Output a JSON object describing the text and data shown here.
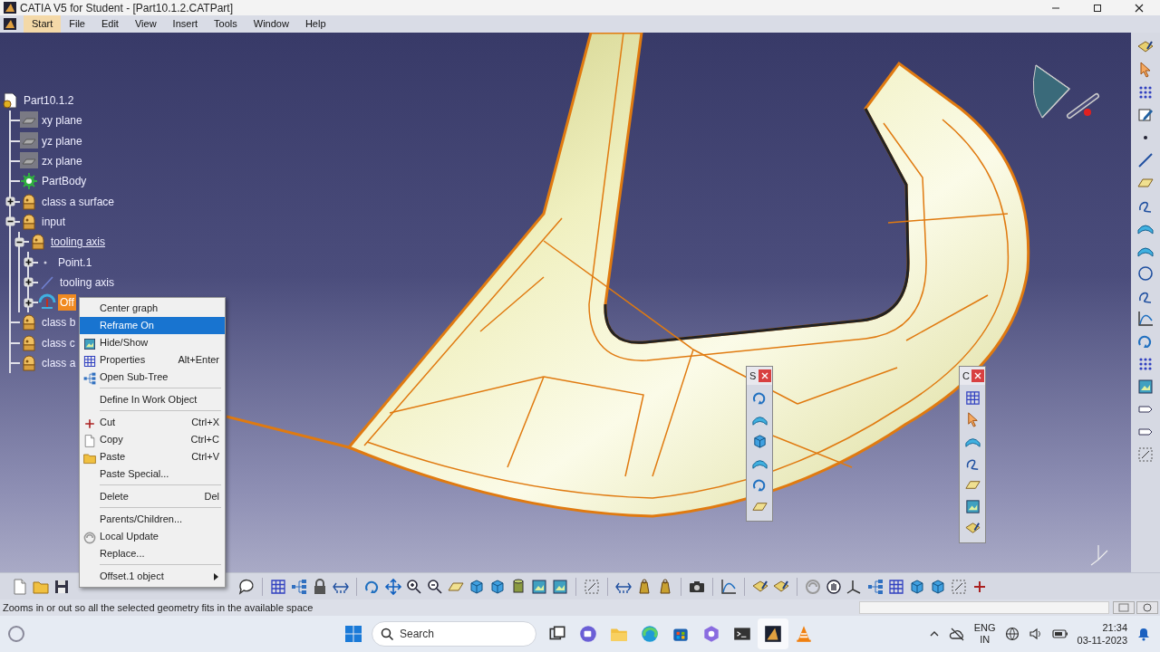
{
  "window": {
    "title": "CATIA V5 for Student - [Part10.1.2.CATPart]"
  },
  "menu_bar": [
    {
      "label": "Start",
      "selected": true
    },
    {
      "label": "File",
      "selected": false
    },
    {
      "label": "Edit",
      "selected": false
    },
    {
      "label": "View",
      "selected": false
    },
    {
      "label": "Insert",
      "selected": false
    },
    {
      "label": "Tools",
      "selected": false
    },
    {
      "label": "Window",
      "selected": false
    },
    {
      "label": "Help",
      "selected": false
    }
  ],
  "tree": {
    "label": "Part10.1.2",
    "kind": "part",
    "selected": false,
    "in_work": false,
    "children": [
      {
        "label": "xy plane",
        "kind": "plane",
        "selected": false,
        "in_work": false
      },
      {
        "label": "yz plane",
        "kind": "plane",
        "selected": false,
        "in_work": false
      },
      {
        "label": "zx plane",
        "kind": "plane",
        "selected": false,
        "in_work": false
      },
      {
        "label": "PartBody",
        "kind": "body",
        "selected": false,
        "in_work": false
      },
      {
        "label": "class a surface",
        "kind": "set",
        "selected": false,
        "in_work": false,
        "expanded": false
      },
      {
        "label": "input",
        "kind": "set",
        "selected": false,
        "in_work": false,
        "expanded": true,
        "children": [
          {
            "label": "tooling axis",
            "kind": "set",
            "selected": false,
            "in_work": true,
            "expanded": true,
            "children": [
              {
                "label": "Point.1",
                "kind": "point",
                "selected": false,
                "in_work": false,
                "expanded": false
              },
              {
                "label": "tooling axis",
                "kind": "line",
                "selected": false,
                "in_work": false,
                "expanded": false
              },
              {
                "label": "Off",
                "kind": "offset",
                "selected": true,
                "in_work": false,
                "expanded": false
              }
            ]
          }
        ]
      },
      {
        "label": "class b",
        "kind": "set",
        "selected": false,
        "in_work": false
      },
      {
        "label": "class c",
        "kind": "set",
        "selected": false,
        "in_work": false
      },
      {
        "label": "class a",
        "kind": "set",
        "selected": false,
        "in_work": false
      }
    ]
  },
  "context_menu": {
    "items": [
      {
        "kind": "item",
        "label": "Center graph",
        "selected": false
      },
      {
        "kind": "item",
        "label": "Reframe On",
        "selected": true
      },
      {
        "kind": "item",
        "label": "Hide/Show",
        "selected": false
      },
      {
        "kind": "item",
        "label": "Properties",
        "shortcut": "Alt+Enter",
        "selected": false
      },
      {
        "kind": "item",
        "label": "Open Sub-Tree",
        "selected": false
      },
      {
        "kind": "separator"
      },
      {
        "kind": "item",
        "label": "Define In Work Object",
        "selected": false
      },
      {
        "kind": "separator"
      },
      {
        "kind": "item",
        "label": "Cut",
        "shortcut": "Ctrl+X",
        "selected": false
      },
      {
        "kind": "item",
        "label": "Copy",
        "shortcut": "Ctrl+C",
        "selected": false
      },
      {
        "kind": "item",
        "label": "Paste",
        "shortcut": "Ctrl+V",
        "selected": false
      },
      {
        "kind": "item",
        "label": "Paste Special...",
        "selected": false
      },
      {
        "kind": "separator"
      },
      {
        "kind": "item",
        "label": "Delete",
        "shortcut": "Del",
        "selected": false
      },
      {
        "kind": "separator"
      },
      {
        "kind": "item",
        "label": "Parents/Children...",
        "selected": false
      },
      {
        "kind": "item",
        "label": "Local Update",
        "selected": false
      },
      {
        "kind": "item",
        "label": "Replace...",
        "selected": false
      },
      {
        "kind": "separator"
      },
      {
        "kind": "submenu",
        "label": "Offset.1 object",
        "selected": false
      }
    ]
  },
  "floating_toolbars": [
    {
      "title": "S"
    },
    {
      "title": "C"
    }
  ],
  "status_bar": {
    "message": "Zooms in or out so all the selected geometry fits in the available space"
  },
  "taskbar": {
    "search": {
      "placeholder": "Search"
    },
    "language": "ENG",
    "region": "IN",
    "time": "21:34",
    "date": "03-11-2023"
  }
}
